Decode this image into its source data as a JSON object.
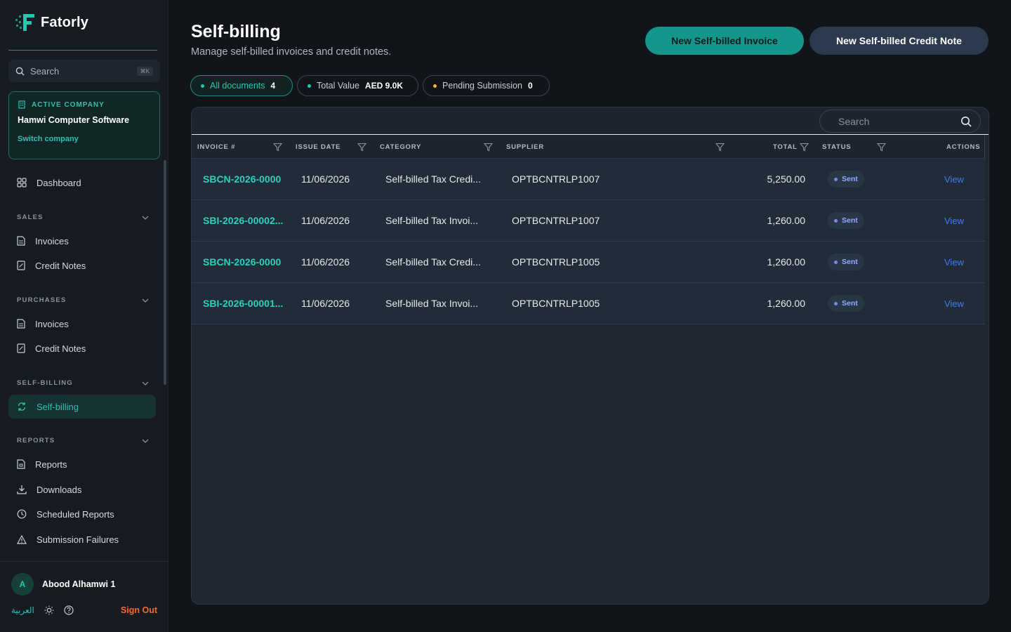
{
  "app": {
    "name": "Fatorly"
  },
  "sidebar": {
    "search": {
      "label": "Search",
      "shortcut": "⌘K"
    },
    "company": {
      "label": "ACTIVE COMPANY",
      "name": "Hamwi Computer Software",
      "switch_label": "Switch company"
    },
    "dashboard": "Dashboard",
    "sections": {
      "sales": {
        "title": "SALES",
        "items": [
          "Invoices",
          "Credit Notes"
        ]
      },
      "purchases": {
        "title": "PURCHASES",
        "items": [
          "Invoices",
          "Credit Notes"
        ]
      },
      "self_billing": {
        "title": "SELF-BILLING",
        "items": [
          "Self-billing"
        ]
      },
      "reports": {
        "title": "REPORTS",
        "items": [
          "Reports",
          "Downloads",
          "Scheduled Reports",
          "Submission Failures"
        ]
      }
    },
    "user": {
      "initial": "A",
      "name": "Abood Alhamwi 1"
    },
    "language": "العربية",
    "sign_out": "Sign Out"
  },
  "page": {
    "title": "Self-billing",
    "subtitle": "Manage self-billed invoices and credit notes.",
    "buttons": {
      "new_invoice": "New Self-billed Invoice",
      "new_credit_note": "New Self-billed Credit Note"
    },
    "chips": [
      {
        "label": "All documents",
        "value": "4",
        "dot_color": "#2bc4b2"
      },
      {
        "label": "Total Value",
        "value": "AED 9.0K",
        "dot_color": "#2bc4b2"
      },
      {
        "label": "Pending Submission",
        "value": "0",
        "dot_color": "#f5b82e"
      }
    ]
  },
  "table": {
    "search_placeholder": "Search",
    "columns": {
      "invoice": "INVOICE #",
      "issue_date": "ISSUE DATE",
      "category": "CATEGORY",
      "supplier": "SUPPLIER",
      "total": "TOTAL",
      "status": "STATUS",
      "actions": "ACTIONS"
    },
    "rows": [
      {
        "invoice": "SBCN-2026-0000",
        "date": "11/06/2026",
        "category": "Self-billed Tax Credi...",
        "supplier": "OPTBCNTRLP1007",
        "total": "5,250.00",
        "status": "Sent",
        "action": "View"
      },
      {
        "invoice": "SBI-2026-00002...",
        "date": "11/06/2026",
        "category": "Self-billed Tax Invoi...",
        "supplier": "OPTBCNTRLP1007",
        "total": "1,260.00",
        "status": "Sent",
        "action": "View"
      },
      {
        "invoice": "SBCN-2026-0000",
        "date": "11/06/2026",
        "category": "Self-billed Tax Credi...",
        "supplier": "OPTBCNTRLP1005",
        "total": "1,260.00",
        "status": "Sent",
        "action": "View"
      },
      {
        "invoice": "SBI-2026-00001...",
        "date": "11/06/2026",
        "category": "Self-billed Tax Invoi...",
        "supplier": "OPTBCNTRLP1005",
        "total": "1,260.00",
        "status": "Sent",
        "action": "View"
      }
    ]
  },
  "colors": {
    "accent": "#14968a",
    "accent_text": "#2bc4b2",
    "link": "#3d7bf5",
    "danger": "#f26b2f"
  }
}
